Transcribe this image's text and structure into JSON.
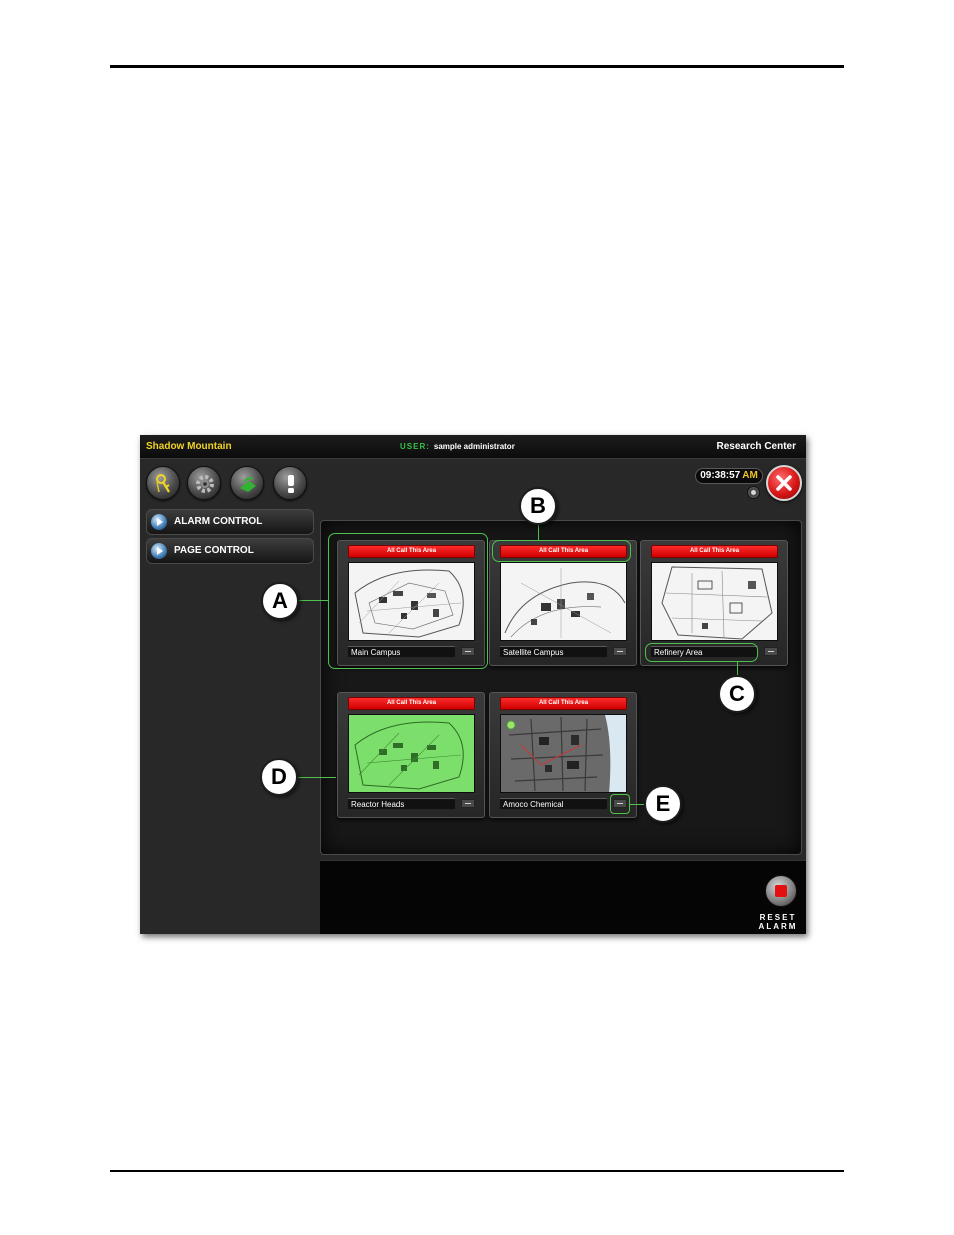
{
  "header": {
    "brand": "Shadow Mountain",
    "user_tag": "USER:",
    "user_name": "sample administrator",
    "site_name": "Research Center"
  },
  "toolbar": {
    "buttons": [
      "key-icon",
      "gear-icon",
      "pager-icon",
      "alert-icon"
    ],
    "accent_colors": {
      "key": "#f1d324",
      "pager": "#2fb52f",
      "brand": "#f1d324",
      "all_call": "#e20000"
    }
  },
  "clock": {
    "time": "09:38:57",
    "ampm": "AM"
  },
  "sidebar": {
    "items": [
      {
        "label": "ALARM CONTROL"
      },
      {
        "label": "PAGE CONTROL"
      }
    ]
  },
  "areas": [
    {
      "all_call": "All Call This Area",
      "name": "Main Campus",
      "state": "normal"
    },
    {
      "all_call": "All Call This Area",
      "name": "Satellite Campus",
      "state": "normal"
    },
    {
      "all_call": "All Call This Area",
      "name": "Refinery Area",
      "state": "normal"
    },
    {
      "all_call": "All Call This Area",
      "name": "Reactor Heads",
      "state": "highlighted"
    },
    {
      "all_call": "All Call This Area",
      "name": "Amoco Chemical",
      "state": "dark"
    }
  ],
  "reset": {
    "line1": "RESET",
    "line2": "ALARM"
  },
  "callouts": {
    "a": "A",
    "b": "B",
    "c": "C",
    "d": "D",
    "e": "E"
  }
}
